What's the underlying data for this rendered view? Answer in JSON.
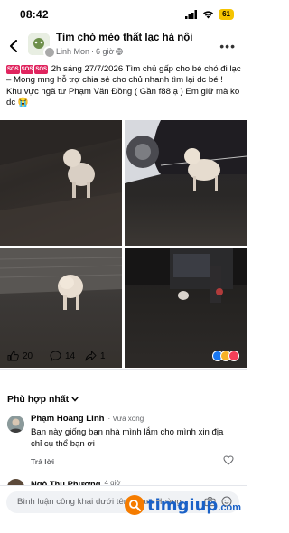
{
  "status": {
    "time": "08:42",
    "battery": "61"
  },
  "header": {
    "group_name": "Tìm chó mèo thất lạc hà nội",
    "author": "Linh Mon",
    "time_ago": "6 giờ"
  },
  "post": {
    "line1": "2h sáng 27/7/2026 Tìm chủ gấp cho bé chó đi lạc –  Mong mng hỗ trợ chia sẻ cho chủ nhanh tìm lại dc bé !",
    "line2": "Khu vực ngã tư Phạm Văn Đồng ( Gần f88 ạ ) Em giữ mà ko dc",
    "sos_label": "SOS",
    "emoji": "😭"
  },
  "stats": {
    "likes": "20",
    "comments": "14",
    "shares": "1"
  },
  "sort": {
    "label": "Phù hợp nhất"
  },
  "comments": [
    {
      "author": "Phạm Hoàng Linh",
      "time": "Vừa xong",
      "text": "Bạn này giống bạn nhà mình lắm cho mình xin địa chỉ cụ thể bạn ơi",
      "reply_label": "Trả lời"
    },
    {
      "author": "Ngô Thu Phương",
      "time": "4 giờ"
    }
  ],
  "input": {
    "placeholder": "Bình luận công khai dưới tên Phạm Hoàng..."
  },
  "watermark": {
    "brand": "timgiup",
    "suffix": ".com"
  },
  "colors": {
    "accent": "#1877f2",
    "sos": "#e0245e",
    "battery": "#f5c400",
    "watermark": "#1a61c7"
  }
}
